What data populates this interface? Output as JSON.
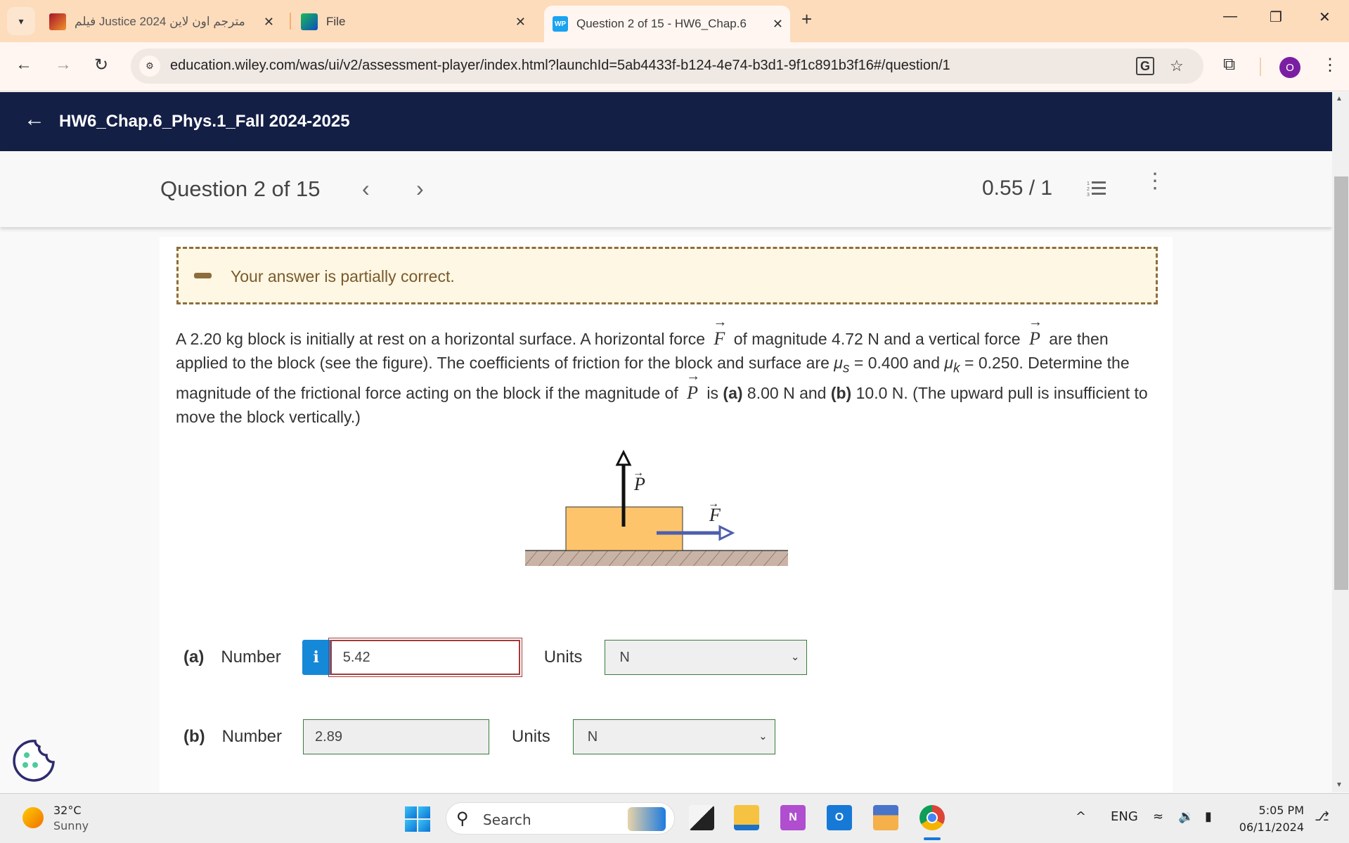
{
  "browser": {
    "tabs": [
      {
        "title": "فيلم Justice 2024 مترجم اون لاين",
        "active": false
      },
      {
        "title": "File",
        "active": false
      },
      {
        "title": "Question 2 of 15 - HW6_Chap.6",
        "active": true
      }
    ],
    "url": "education.wiley.com/was/ui/v2/assessment-player/index.html?launchId=5ab4433f-b124-4e74-b3d1-9f1c891b3f16#/question/1",
    "profile_initial": "O",
    "icons": {
      "tab_list": "▾",
      "close": "✕",
      "new_tab": "+",
      "minimize": "—",
      "restore": "❐",
      "window_close": "✕",
      "back": "←",
      "forward": "→",
      "reload": "↻",
      "site_info": "⚙",
      "translate": "G",
      "bookmark": "☆",
      "extensions": "⧉",
      "menu": "⋮"
    }
  },
  "header": {
    "back_icon": "←",
    "course_title": "HW6_Chap.6_Phys.1_Fall 2024-2025"
  },
  "question_bar": {
    "title": "Question 2 of 15",
    "prev_icon": "‹",
    "next_icon": "›",
    "score": "0.55 / 1",
    "menu_icon": "⋮"
  },
  "feedback": {
    "message": "Your answer is partially correct.",
    "color": "#8d6d3d"
  },
  "problem": {
    "segments": {
      "s1": "A 2.20 kg block is initially at rest on a horizontal surface. A horizontal force",
      "F": "F",
      "s2": "of magnitude 4.72 N and a vertical force",
      "P": "P",
      "s3": "are then applied to the block (see the figure). The coefficients of friction for the block and surface are",
      "mu": "μ",
      "sub_s": "s",
      "s4": "= 0.400 and",
      "sub_k": "k",
      "s5": "= 0.250. Determine the magnitude of the frictional force acting on the block if the magnitude of",
      "s6": "is",
      "a": "(a)",
      "s7": "8.00 N and",
      "b": "(b)",
      "s8": "10.0 N. (The upward pull is insufficient to move the block vertically.)"
    },
    "figure": {
      "P_label": "P",
      "F_label": "F",
      "block_color": "#fdc46c",
      "F_arrow_color": "#4d5eab"
    }
  },
  "answers": [
    {
      "part": "(a)",
      "label": "Number",
      "value": "5.42",
      "units_label": "Units",
      "unit": "N",
      "status": "incorrect",
      "info_icon": "i"
    },
    {
      "part": "(b)",
      "label": "Number",
      "value": "2.89",
      "units_label": "Units",
      "unit": "N",
      "status": "correct"
    }
  ],
  "taskbar": {
    "weather_temp": "32°C",
    "weather_cond": "Sunny",
    "search_placeholder": "Search",
    "language": "ENG",
    "time": "5:05 PM",
    "date": "06/11/2024",
    "tray_chevron": "^",
    "bell": "🔔"
  }
}
